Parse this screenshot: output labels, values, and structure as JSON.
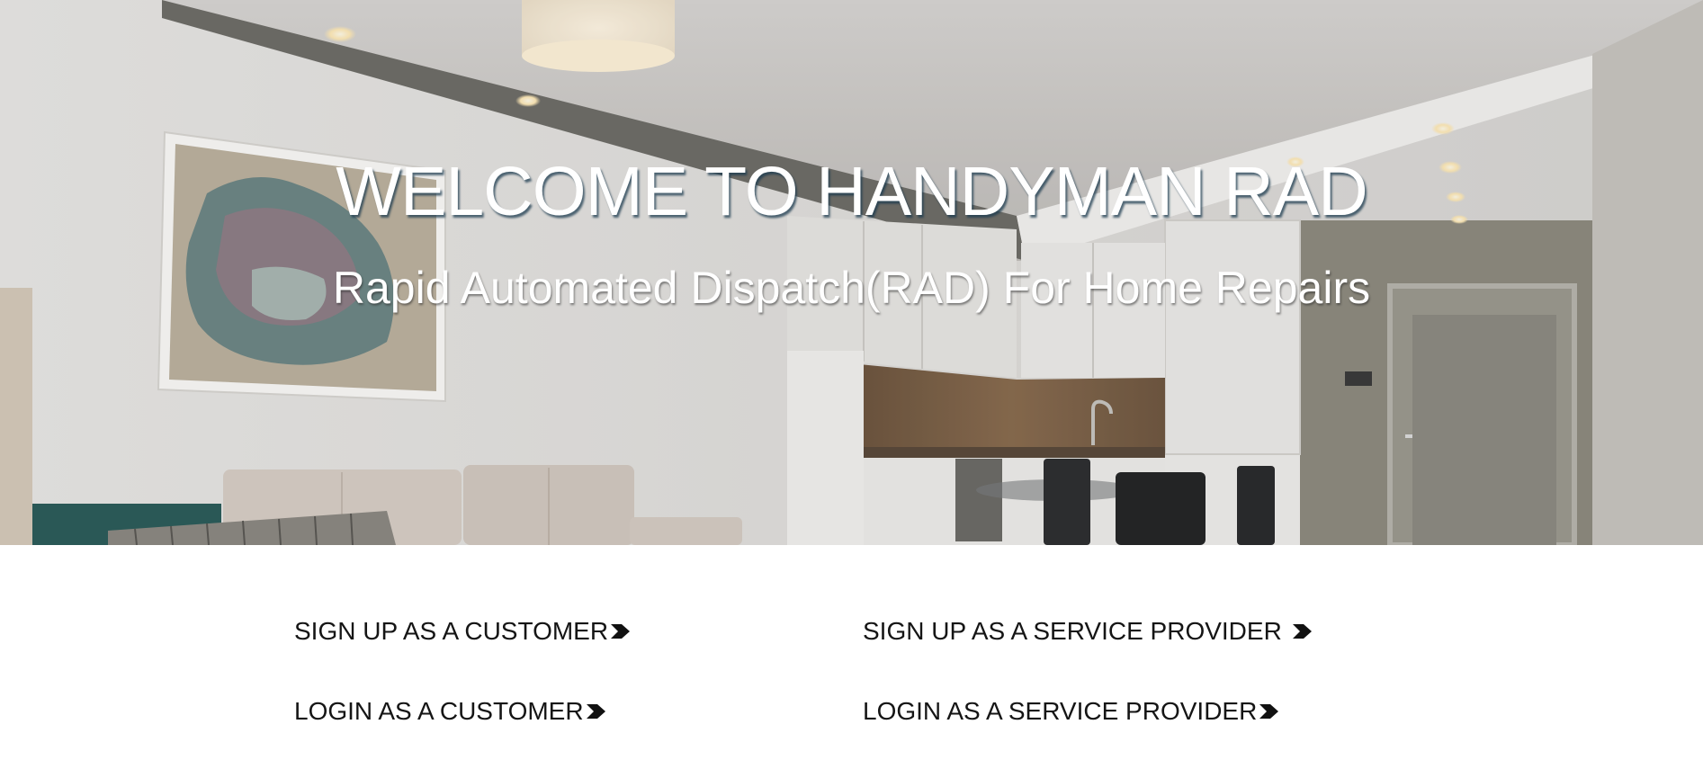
{
  "hero": {
    "title": "WELCOME TO HANDYMAN RAD",
    "subtitle": "Rapid Automated Dispatch(RAD) For Home Repairs"
  },
  "links": {
    "customer_signup": "SIGN UP AS A CUSTOMER",
    "customer_login": "LOGIN AS A CUSTOMER",
    "provider_signup": "SIGN UP AS A SERVICE PROVIDER",
    "provider_login": "LOGIN AS A SERVICE PROVIDER"
  },
  "icons": {
    "link_arrow": "chevron-right-icon"
  },
  "colors": {
    "link_text": "#151515",
    "hero_text": "#ffffff"
  }
}
